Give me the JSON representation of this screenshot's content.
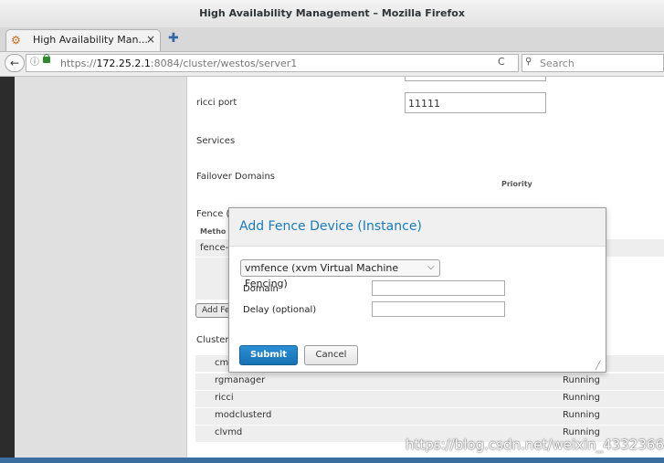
{
  "window": {
    "title": "High Availability Management – Mozilla Firefox"
  },
  "tab": {
    "title": "High Availability Man...",
    "close": "×",
    "new_tab": "✚"
  },
  "nav": {
    "back": "←",
    "info": "ⓘ",
    "url_prefix": "https://",
    "url_host": "172.25.2.1",
    "url_rest": ":8084/cluster/westos/server1",
    "reload": "C",
    "search_icon": "⚲",
    "search_placeholder": "Search"
  },
  "page": {
    "ricci_port_label": "ricci port",
    "ricci_port_value": "11111",
    "services_label": "Services",
    "failover_label": "Failover Domains",
    "priority_header": "Priority",
    "fence_label_partial": "Fence (",
    "method_partial": "Metho",
    "fence_row_partial": "fence-",
    "add_fence_partial": "Add Fe",
    "cluster_partial": "Cluster",
    "daemons": [
      {
        "name": "cm",
        "status": ""
      },
      {
        "name": "rgmanager",
        "status": "Running"
      },
      {
        "name": "ricci",
        "status": "Running"
      },
      {
        "name": "modclusterd",
        "status": "Running"
      },
      {
        "name": "clvmd",
        "status": "Running"
      }
    ]
  },
  "modal": {
    "title": "Add Fence Device (Instance)",
    "select_value": "vmfence (xvm Virtual Machine Fencing)",
    "domain_label": "Domain",
    "delay_label": "Delay (optional)",
    "submit": "Submit",
    "cancel": "Cancel"
  },
  "watermark": "https://blog.csdn.net/weixin_43323669",
  "colors": {
    "accent": "#1a7bb9",
    "submit_bg": "#1672b3",
    "sidebar": "#e0e0e0",
    "bottom_bar": "#3a6e9e"
  }
}
